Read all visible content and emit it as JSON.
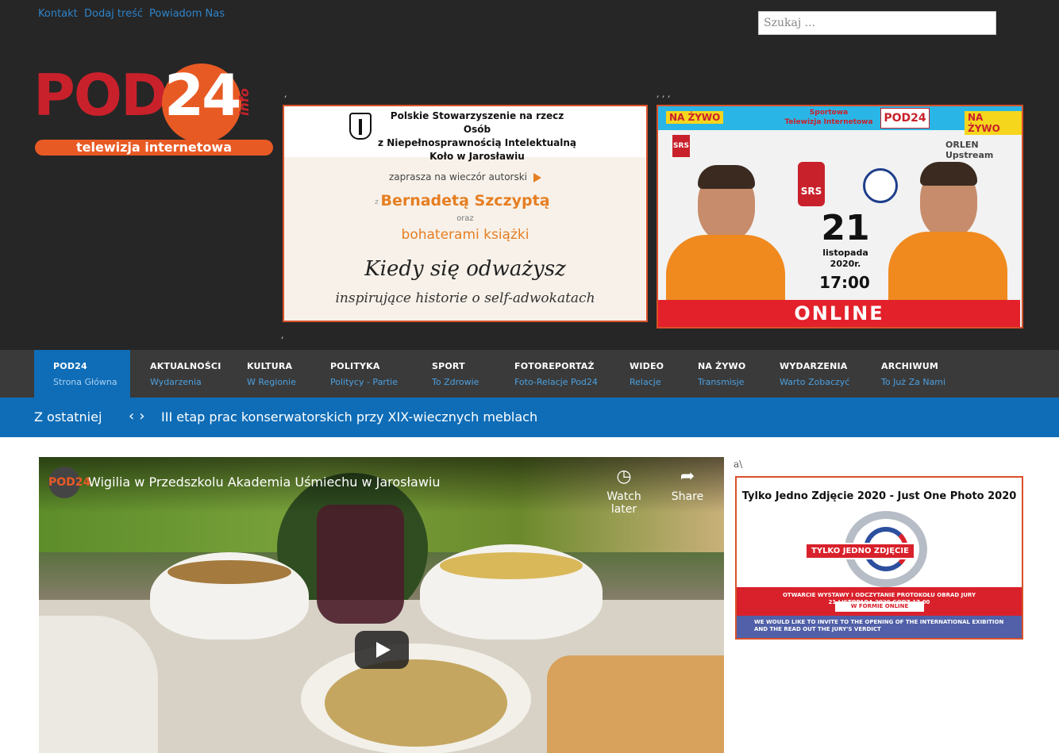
{
  "top_links": [
    "Kontakt",
    "Dodaj treść",
    "Powiadom Nas"
  ],
  "search": {
    "placeholder": "Szukaj ..."
  },
  "logo": {
    "main": "POD",
    "number": "24",
    "suffix": "info",
    "tagline": "telewizja internetowa"
  },
  "stray_marks": {
    "a": ",",
    "b": ", , ,",
    "c": ",",
    "side": "a\\"
  },
  "banner_left": {
    "org_line1": "Polskie Stowarzyszenie na rzecz Osób",
    "org_line2": "z Niepełnosprawnością Intelektualną",
    "org_line3": "Koło w Jarosławiu",
    "invite": "zaprasza na wieczór autorski",
    "with": "z",
    "author": "Bernadetą Szczyptą",
    "and": "oraz",
    "heroes": "bohaterami książki",
    "book": "Kiedy się odważysz",
    "subtitle": "inspirujące historie o self-adwokatach"
  },
  "banner_right": {
    "live_left": "NA ŻYWO",
    "live_right": "NA ŻYWO",
    "station_line1": "Sportowa",
    "station_line2": "Telewizja Internetowa",
    "brand": "POD24",
    "sponsor": "ORLEN Upstream",
    "club": "SRS",
    "day": "21",
    "month": "listopada",
    "year": "2020r.",
    "time": "17:00",
    "online": "ONLINE"
  },
  "nav": [
    {
      "label": "POD24",
      "sub": "Strona Główna",
      "active": true
    },
    {
      "label": "AKTUALNOŚCI",
      "sub": "Wydarzenia"
    },
    {
      "label": "KULTURA",
      "sub": "W Regionie"
    },
    {
      "label": "POLITYKA",
      "sub": "Politycy - Partie"
    },
    {
      "label": "SPORT",
      "sub": "To Zdrowie"
    },
    {
      "label": "FOTOREPORTAŻ",
      "sub": "Foto-Relacje Pod24"
    },
    {
      "label": "WIDEO",
      "sub": "Relacje"
    },
    {
      "label": "NA ŻYWO",
      "sub": "Transmisje"
    },
    {
      "label": "WYDARZENIA",
      "sub": "Warto Zobaczyć"
    },
    {
      "label": "ARCHIWUM",
      "sub": "To Już Za Nami"
    }
  ],
  "ticker": {
    "label": "Z ostatniej",
    "headline": "III etap prac konserwatorskich przy XIX-wiecznych meblach"
  },
  "video": {
    "channel": "POD24",
    "title": "Wigilia w Przedszkolu Akademia Uśmiechu w Jarosławiu",
    "watch_later": "Watch later",
    "share": "Share",
    "icons": {
      "watch_later": "clock-icon",
      "share": "share-arrow-icon",
      "play": "play-icon"
    }
  },
  "side_ad": {
    "title": "Tylko Jedno Zdjęcie 2020 - Just One Photo 2020",
    "logo_label": "TYLKO JEDNO ZDJĘCIE",
    "red_line1": "OTWARCIE WYSTAWY I ODCZYTANIE PROTOKOŁU OBRAD JURY",
    "red_line2": "21 LISTOPADA 2020 GODZ.17.00",
    "online_label": "W FORMIE ONLINE",
    "blue_text": "WE WOULD LIKE TO INVITE TO THE OPENING OF THE INTERNATIONAL EXIBITION AND THE READ OUT THE JURY'S VERDICT"
  },
  "colors": {
    "accent_blue": "#0f6db7",
    "brand_red": "#c9212b",
    "brand_orange": "#e85a24",
    "header_bg": "#262626",
    "nav_bg": "#3a3a3a"
  }
}
